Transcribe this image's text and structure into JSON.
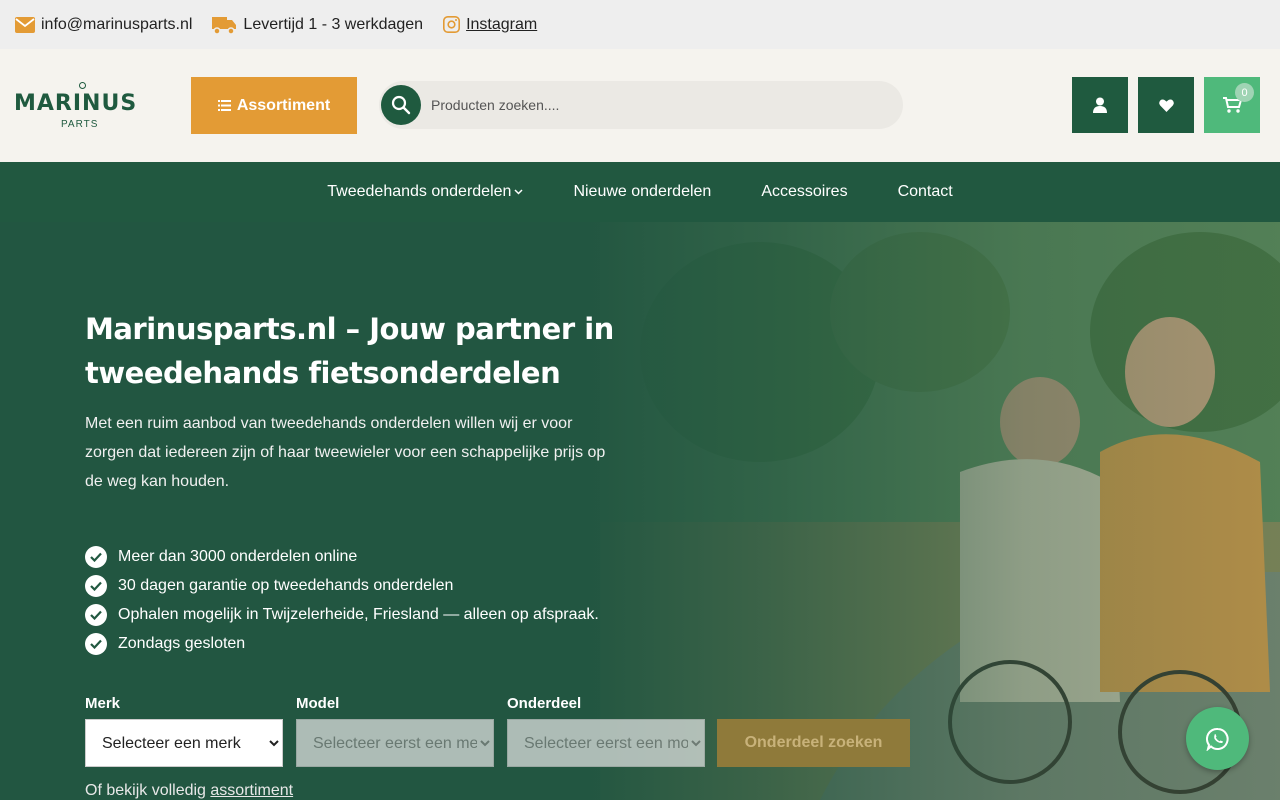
{
  "topbar": {
    "email": "info@marinusparts.nl",
    "delivery": "Levertijd 1 - 3 werkdagen",
    "instagram": "Instagram"
  },
  "header": {
    "logo_brand": "MARINUS",
    "logo_sub": "PARTS",
    "assortiment_label": "Assortiment",
    "search_placeholder": "Producten zoeken....",
    "cart_count": "0"
  },
  "nav": {
    "items": [
      "Tweedehands onderdelen",
      "Nieuwe onderdelen",
      "Accessoires",
      "Contact"
    ]
  },
  "hero": {
    "title": "Marinusparts.nl – Jouw partner in tweedehands fietsonderdelen",
    "intro": "Met een ruim aanbod van tweedehands onderdelen willen wij er voor zorgen dat iedereen zijn of haar tweewieler voor een schappelijke prijs op de weg kan houden.",
    "checks": [
      "Meer dan 3000 onderdelen online",
      "30 dagen garantie op tweedehands onderdelen",
      "Ophalen mogelijk in Twijzelerheide, Friesland — alleen op afspraak.",
      "Zondags gesloten"
    ],
    "filter": {
      "merk_label": "Merk",
      "merk_value": "Selecteer een merk",
      "model_label": "Model",
      "model_value": "Selecteer eerst een merk",
      "onderdeel_label": "Onderdeel",
      "onderdeel_value": "Selecteer eerst een model",
      "search_button": "Onderdeel zoeken"
    },
    "more_prefix": "Of bekijk volledig",
    "more_link": "assortiment"
  },
  "colors": {
    "brand_green": "#215840",
    "accent_orange": "#e39b35",
    "cart_green": "#4fb97b"
  }
}
